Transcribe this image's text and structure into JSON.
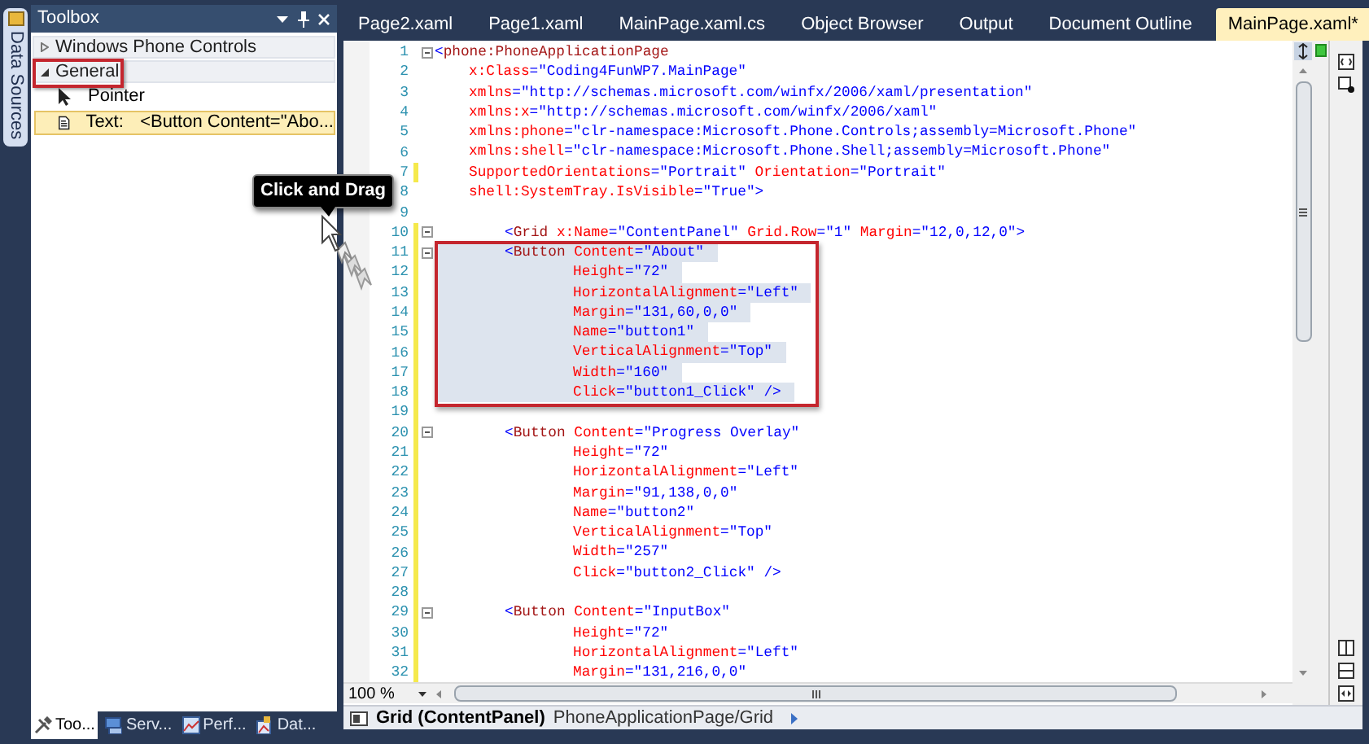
{
  "side_tab": {
    "label": "Data Sources"
  },
  "toolbox": {
    "title": "Toolbox",
    "groups": [
      {
        "label": "Windows Phone Controls",
        "expanded": false,
        "highlighted": false
      },
      {
        "label": "General",
        "expanded": true,
        "highlighted": true,
        "items": [
          {
            "kind": "pointer",
            "label": "Pointer",
            "selected": false
          },
          {
            "kind": "snippet",
            "label": "Text:",
            "value": "<Button Content=\"Abo...",
            "selected": true
          }
        ]
      }
    ]
  },
  "panel_tabs": [
    {
      "kind": "toolbox",
      "label": "Too...",
      "selected": true
    },
    {
      "kind": "server",
      "label": "Serv...",
      "selected": false
    },
    {
      "kind": "performance",
      "label": "Perf...",
      "selected": false
    },
    {
      "kind": "data",
      "label": "Dat...",
      "selected": false
    }
  ],
  "callout": {
    "text": "Click and Drag"
  },
  "editor": {
    "tabs": [
      {
        "label": "Page2.xaml",
        "selected": false
      },
      {
        "label": "Page1.xaml",
        "selected": false
      },
      {
        "label": "MainPage.xaml.cs",
        "selected": false
      },
      {
        "label": "Object Browser",
        "selected": false
      },
      {
        "label": "Output",
        "selected": false
      },
      {
        "label": "Document Outline",
        "selected": false
      },
      {
        "label": "MainPage.xaml*",
        "selected": true
      }
    ],
    "lines": [
      {
        "number": "1",
        "kind": "root",
        "foldable": true,
        "changed": false,
        "selected": false,
        "tokens": [
          {
            "kind": "punct",
            "text": "<"
          },
          {
            "kind": "element",
            "text": "phone:PhoneApplicationPage"
          }
        ]
      },
      {
        "number": "2",
        "kind": "root_attr",
        "foldable": false,
        "changed": false,
        "selected": false,
        "tokens": [
          {
            "kind": "attr",
            "text": "x:Class"
          },
          {
            "kind": "value",
            "text": "=\"Coding4FunWP7.MainPage\""
          }
        ]
      },
      {
        "number": "3",
        "kind": "root_attr",
        "foldable": false,
        "changed": false,
        "selected": false,
        "tokens": [
          {
            "kind": "attr",
            "text": "xmlns"
          },
          {
            "kind": "value",
            "text": "=\"http://schemas.microsoft.com/winfx/2006/xaml/presentation\""
          }
        ]
      },
      {
        "number": "4",
        "kind": "root_attr",
        "foldable": false,
        "changed": false,
        "selected": false,
        "tokens": [
          {
            "kind": "attr",
            "text": "xmlns:x"
          },
          {
            "kind": "value",
            "text": "=\"http://schemas.microsoft.com/winfx/2006/xaml\""
          }
        ]
      },
      {
        "number": "5",
        "kind": "root_attr",
        "foldable": false,
        "changed": false,
        "selected": false,
        "tokens": [
          {
            "kind": "attr",
            "text": "xmlns:phone"
          },
          {
            "kind": "value",
            "text": "=\"clr-namespace:Microsoft.Phone.Controls;assembly=Microsoft.Phone\""
          }
        ]
      },
      {
        "number": "6",
        "kind": "root_attr",
        "foldable": false,
        "changed": false,
        "selected": false,
        "tokens": [
          {
            "kind": "attr",
            "text": "xmlns:shell"
          },
          {
            "kind": "value",
            "text": "=\"clr-namespace:Microsoft.Phone.Shell;assembly=Microsoft.Phone\""
          }
        ]
      },
      {
        "number": "7",
        "kind": "root_attr",
        "foldable": false,
        "changed": true,
        "selected": false,
        "tokens": [
          {
            "kind": "attr",
            "text": "SupportedOrientations"
          },
          {
            "kind": "value",
            "text": "=\"Portrait\" "
          },
          {
            "kind": "attr",
            "text": "Orientation"
          },
          {
            "kind": "value",
            "text": "=\"Portrait\""
          }
        ]
      },
      {
        "number": "8",
        "kind": "root_attr",
        "foldable": false,
        "changed": false,
        "selected": false,
        "tokens": [
          {
            "kind": "attr",
            "text": "shell:SystemTray.IsVisible"
          },
          {
            "kind": "value",
            "text": "=\"True\""
          },
          {
            "kind": "punct",
            "text": ">"
          }
        ]
      },
      {
        "number": "9",
        "kind": "blank",
        "foldable": false,
        "changed": false,
        "selected": false
      },
      {
        "number": "10",
        "kind": "child",
        "foldable": true,
        "changed": true,
        "selected": false,
        "tokens": [
          {
            "kind": "punct",
            "text": "<"
          },
          {
            "kind": "element",
            "text": "Grid"
          },
          {
            "kind": "attr",
            "text": " x:Name"
          },
          {
            "kind": "value",
            "text": "=\"ContentPanel\""
          },
          {
            "kind": "attr",
            "text": " Grid.Row"
          },
          {
            "kind": "value",
            "text": "=\"1\""
          },
          {
            "kind": "attr",
            "text": " Margin"
          },
          {
            "kind": "value",
            "text": "=\"12,0,12,0\""
          },
          {
            "kind": "punct",
            "text": ">"
          }
        ]
      },
      {
        "number": "11",
        "kind": "child",
        "foldable": true,
        "changed": true,
        "selected": true,
        "tokens": [
          {
            "kind": "punct",
            "text": "<"
          },
          {
            "kind": "element",
            "text": "Button"
          },
          {
            "kind": "attr",
            "text": " Content"
          },
          {
            "kind": "value",
            "text": "=\"About\""
          }
        ]
      },
      {
        "number": "12",
        "kind": "child_attr",
        "foldable": false,
        "changed": true,
        "selected": true,
        "tokens": [
          {
            "kind": "attr",
            "text": "Height"
          },
          {
            "kind": "value",
            "text": "=\"72\""
          }
        ]
      },
      {
        "number": "13",
        "kind": "child_attr",
        "foldable": false,
        "changed": true,
        "selected": true,
        "tokens": [
          {
            "kind": "attr",
            "text": "HorizontalAlignment"
          },
          {
            "kind": "value",
            "text": "=\"Left\""
          }
        ]
      },
      {
        "number": "14",
        "kind": "child_attr",
        "foldable": false,
        "changed": true,
        "selected": true,
        "tokens": [
          {
            "kind": "attr",
            "text": "Margin"
          },
          {
            "kind": "value",
            "text": "=\"131,60,0,0\""
          }
        ]
      },
      {
        "number": "15",
        "kind": "child_attr",
        "foldable": false,
        "changed": true,
        "selected": true,
        "tokens": [
          {
            "kind": "attr",
            "text": "Name"
          },
          {
            "kind": "value",
            "text": "=\"button1\""
          }
        ]
      },
      {
        "number": "16",
        "kind": "child_attr",
        "foldable": false,
        "changed": true,
        "selected": true,
        "tokens": [
          {
            "kind": "attr",
            "text": "VerticalAlignment"
          },
          {
            "kind": "value",
            "text": "=\"Top\""
          }
        ]
      },
      {
        "number": "17",
        "kind": "child_attr",
        "foldable": false,
        "changed": true,
        "selected": true,
        "tokens": [
          {
            "kind": "attr",
            "text": "Width"
          },
          {
            "kind": "value",
            "text": "=\"160\""
          }
        ]
      },
      {
        "number": "18",
        "kind": "child_attr",
        "foldable": false,
        "changed": true,
        "selected": true,
        "tokens": [
          {
            "kind": "attr",
            "text": "Click"
          },
          {
            "kind": "value",
            "text": "=\"button1_Click\" "
          },
          {
            "kind": "punct",
            "text": "/>"
          }
        ]
      },
      {
        "number": "19",
        "kind": "blank",
        "foldable": false,
        "changed": true,
        "selected": false
      },
      {
        "number": "20",
        "kind": "child",
        "foldable": true,
        "changed": true,
        "selected": false,
        "tokens": [
          {
            "kind": "punct",
            "text": "<"
          },
          {
            "kind": "element",
            "text": "Button"
          },
          {
            "kind": "attr",
            "text": " Content"
          },
          {
            "kind": "value",
            "text": "=\"Progress Overlay\""
          }
        ]
      },
      {
        "number": "21",
        "kind": "child_attr",
        "foldable": false,
        "changed": true,
        "selected": false,
        "tokens": [
          {
            "kind": "attr",
            "text": "Height"
          },
          {
            "kind": "value",
            "text": "=\"72\""
          }
        ]
      },
      {
        "number": "22",
        "kind": "child_attr",
        "foldable": false,
        "changed": true,
        "selected": false,
        "tokens": [
          {
            "kind": "attr",
            "text": "HorizontalAlignment"
          },
          {
            "kind": "value",
            "text": "=\"Left\""
          }
        ]
      },
      {
        "number": "23",
        "kind": "child_attr",
        "foldable": false,
        "changed": true,
        "selected": false,
        "tokens": [
          {
            "kind": "attr",
            "text": "Margin"
          },
          {
            "kind": "value",
            "text": "=\"91,138,0,0\""
          }
        ]
      },
      {
        "number": "24",
        "kind": "child_attr",
        "foldable": false,
        "changed": true,
        "selected": false,
        "tokens": [
          {
            "kind": "attr",
            "text": "Name"
          },
          {
            "kind": "value",
            "text": "=\"button2\""
          }
        ]
      },
      {
        "number": "25",
        "kind": "child_attr",
        "foldable": false,
        "changed": true,
        "selected": false,
        "tokens": [
          {
            "kind": "attr",
            "text": "VerticalAlignment"
          },
          {
            "kind": "value",
            "text": "=\"Top\""
          }
        ]
      },
      {
        "number": "26",
        "kind": "child_attr",
        "foldable": false,
        "changed": true,
        "selected": false,
        "tokens": [
          {
            "kind": "attr",
            "text": "Width"
          },
          {
            "kind": "value",
            "text": "=\"257\""
          }
        ]
      },
      {
        "number": "27",
        "kind": "child_attr",
        "foldable": false,
        "changed": true,
        "selected": false,
        "tokens": [
          {
            "kind": "attr",
            "text": "Click"
          },
          {
            "kind": "value",
            "text": "=\"button2_Click\" "
          },
          {
            "kind": "punct",
            "text": "/>"
          }
        ]
      },
      {
        "number": "28",
        "kind": "blank",
        "foldable": false,
        "changed": true,
        "selected": false
      },
      {
        "number": "29",
        "kind": "child",
        "foldable": true,
        "changed": true,
        "selected": false,
        "tokens": [
          {
            "kind": "punct",
            "text": "<"
          },
          {
            "kind": "element",
            "text": "Button"
          },
          {
            "kind": "attr",
            "text": " Content"
          },
          {
            "kind": "value",
            "text": "=\"InputBox\""
          }
        ]
      },
      {
        "number": "30",
        "kind": "child_attr",
        "foldable": false,
        "changed": true,
        "selected": false,
        "tokens": [
          {
            "kind": "attr",
            "text": "Height"
          },
          {
            "kind": "value",
            "text": "=\"72\""
          }
        ]
      },
      {
        "number": "31",
        "kind": "child_attr",
        "foldable": false,
        "changed": true,
        "selected": false,
        "tokens": [
          {
            "kind": "attr",
            "text": "HorizontalAlignment"
          },
          {
            "kind": "value",
            "text": "=\"Left\""
          }
        ]
      },
      {
        "number": "32",
        "kind": "child_attr",
        "foldable": false,
        "changed": true,
        "selected": false,
        "tokens": [
          {
            "kind": "attr",
            "text": "Margin"
          },
          {
            "kind": "value",
            "text": "=\"131,216,0,0\""
          }
        ]
      }
    ],
    "zoom": "100 %"
  },
  "status_bar": {
    "element": "Grid (ContentPanel)",
    "path": "PhoneApplicationPage/Grid"
  }
}
